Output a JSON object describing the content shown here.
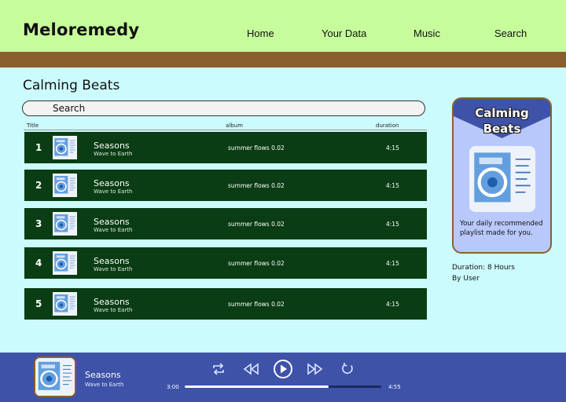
{
  "app": {
    "logo": "Meloremedy"
  },
  "nav": [
    {
      "label": "Home"
    },
    {
      "label": "Your Data"
    },
    {
      "label": "Music"
    },
    {
      "label": "Search"
    }
  ],
  "main": {
    "title": "Calming Beats",
    "search_placeholder": "Search",
    "columns": {
      "title": "Title",
      "album": "album",
      "duration": "duration"
    }
  },
  "tracks": [
    {
      "num": "1",
      "song": "Seasons",
      "artist": "Wave to Earth",
      "album": "summer flows 0.02",
      "duration": "4:15"
    },
    {
      "num": "2",
      "song": "Seasons",
      "artist": "Wave to Earth",
      "album": "summer flows 0.02",
      "duration": "4:15"
    },
    {
      "num": "3",
      "song": "Seasons",
      "artist": "Wave to Earth",
      "album": "summer flows 0.02",
      "duration": "4:15"
    },
    {
      "num": "4",
      "song": "Seasons",
      "artist": "Wave to Earth",
      "album": "summer flows 0.02",
      "duration": "4:15"
    },
    {
      "num": "5",
      "song": "Seasons",
      "artist": "Wave to Earth",
      "album": "summer flows 0.02",
      "duration": "4:15"
    }
  ],
  "playlist_card": {
    "title_line1": "Calming",
    "title_line2": "Beats",
    "description": "Your daily recommended playlist made for you.",
    "duration": "Duration: 8 Hours",
    "by": "By User"
  },
  "player": {
    "song": "Seasons",
    "artist": "Wave to Earth",
    "current_time": "3:00",
    "total_time": "4:55",
    "progress": 0.73,
    "icons": [
      "repeat-icon",
      "previous-icon",
      "play-icon",
      "next-icon",
      "loop-icon"
    ]
  },
  "colors": {
    "header": "#c6fc9c",
    "accent_brown": "#8b5f2d",
    "background": "#ccfbfd",
    "row": "#0a3d14",
    "card": "#b9c8fb",
    "card_top": "#3e52a8",
    "player": "#3e52a8"
  }
}
